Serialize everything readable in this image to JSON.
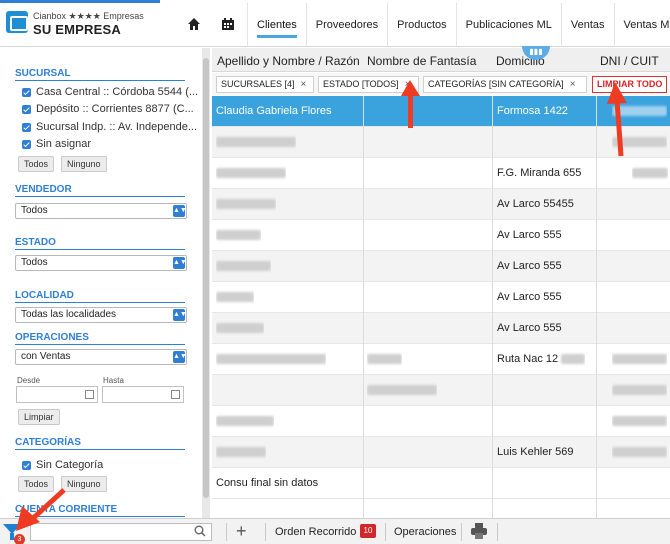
{
  "brand": {
    "product": "Cianbox ★★★★ Empresas",
    "company": "SU EMPRESA"
  },
  "nav": {
    "home_icon": "home-icon",
    "calendar_icon": "calendar-icon",
    "tabs": [
      {
        "label": "Clientes"
      },
      {
        "label": "Proveedores"
      },
      {
        "label": "Productos"
      },
      {
        "label": "Publicaciones ML"
      },
      {
        "label": "Ventas"
      },
      {
        "label": "Ventas ML"
      }
    ]
  },
  "sidebar": {
    "sucursal": {
      "title": "SUCURSAL",
      "items": [
        {
          "label": "Casa Central :: Córdoba 5544 (..."
        },
        {
          "label": "Depósito :: Corrientes 8877 (C..."
        },
        {
          "label": "Sucursal Indp. :: Av. Independe..."
        },
        {
          "label": "Sin asignar"
        }
      ],
      "all": "Todos",
      "none": "Ninguno"
    },
    "vendedor": {
      "title": "VENDEDOR",
      "value": "Todos"
    },
    "estado": {
      "title": "ESTADO",
      "value": "Todos"
    },
    "localidad": {
      "title": "LOCALIDAD",
      "value": "Todas las localidades"
    },
    "operaciones": {
      "title": "OPERACIONES",
      "value": "con Ventas",
      "desde": "Desde",
      "hasta": "Hasta",
      "clear": "Limpiar"
    },
    "categorias": {
      "title": "CATEGORÍAS",
      "items": [
        {
          "label": "Sin Categoría"
        }
      ],
      "all": "Todos",
      "none": "Ninguno"
    },
    "cuenta": {
      "title": "CUENTA CORRIENTE"
    }
  },
  "table": {
    "columns": [
      "Apellido y Nombre / Razón",
      "Nombre de Fantasía",
      "Domicilio",
      "DNI / CUIT"
    ],
    "filters": [
      {
        "label": "SUCURSALES [4]"
      },
      {
        "label": "ESTADO [TODOS]"
      },
      {
        "label": "CATEGORÍAS [SIN CATEGORÍA]"
      }
    ],
    "clear_all": "LIMPIAR TODO",
    "rows": [
      {
        "name": "Claudia Gabriela Flores",
        "fantasia": "",
        "domicilio": "Formosa 1422",
        "dni": ""
      },
      {
        "name": "",
        "fantasia": "",
        "domicilio": "",
        "dni": ""
      },
      {
        "name": "",
        "fantasia": "",
        "domicilio": "F.G. Miranda 655",
        "dni": ""
      },
      {
        "name": "",
        "fantasia": "",
        "domicilio": "Av Larco 55455",
        "dni": ""
      },
      {
        "name": "",
        "fantasia": "",
        "domicilio": "Av Larco 555",
        "dni": ""
      },
      {
        "name": "",
        "fantasia": "",
        "domicilio": "Av Larco 555",
        "dni": ""
      },
      {
        "name": "",
        "fantasia": "",
        "domicilio": "Av Larco 555",
        "dni": ""
      },
      {
        "name": "",
        "fantasia": "",
        "domicilio": "Av Larco 555",
        "dni": ""
      },
      {
        "name": "",
        "fantasia": "",
        "domicilio": "Ruta Nac 12",
        "dni": ""
      },
      {
        "name": "",
        "fantasia": "",
        "domicilio": "",
        "dni": ""
      },
      {
        "name": "",
        "fantasia": "",
        "domicilio": "",
        "dni": ""
      },
      {
        "name": "",
        "fantasia": "",
        "domicilio": "Luis Kehler 569",
        "dni": ""
      },
      {
        "name": "Consu final sin datos",
        "fantasia": "",
        "domicilio": "",
        "dni": ""
      }
    ]
  },
  "bottom": {
    "filter_count": "3",
    "search_placeholder": "",
    "orden": "Orden Recorrido",
    "orden_count": "10",
    "operaciones": "Operaciones"
  },
  "colors": {
    "accent": "#2f7fd6",
    "selected_row": "#3aa3dd",
    "annotation": "#ee3b22",
    "danger": "#d22222"
  }
}
